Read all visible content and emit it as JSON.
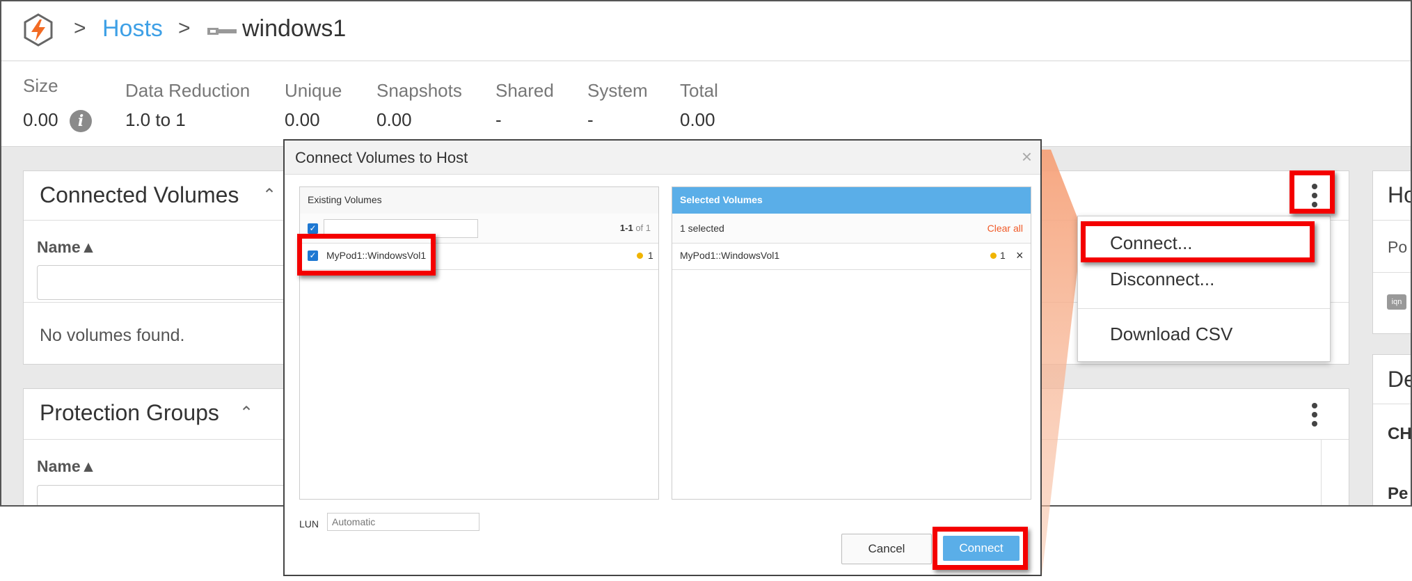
{
  "breadcrumb": {
    "sep1": ">",
    "hosts": "Hosts",
    "sep2": ">",
    "host": "windows1"
  },
  "stats": {
    "size_label": "Size",
    "size_value": "0.00",
    "info_icon": "i",
    "data_reduction_label": "Data Reduction",
    "data_reduction_value": "1.0 to 1",
    "unique_label": "Unique",
    "unique_value": "0.00",
    "snapshots_label": "Snapshots",
    "snapshots_value": "0.00",
    "shared_label": "Shared",
    "shared_value": "-",
    "system_label": "System",
    "system_value": "-",
    "total_label": "Total",
    "total_value": "0.00"
  },
  "connected_volumes": {
    "title": "Connected Volumes",
    "col_name": "Name▲",
    "empty": "No volumes found."
  },
  "protection_groups": {
    "title": "Protection Groups",
    "col_name": "Name▲"
  },
  "right_panels": {
    "p1_title": "Ho",
    "p1_row": "Po",
    "p2_title": "De",
    "p2_row1": "CH",
    "p2_row2": "Pe"
  },
  "menu": {
    "items": [
      "Connect...",
      "Disconnect...",
      "Download CSV"
    ]
  },
  "modal": {
    "title": "Connect Volumes to Host",
    "close": "×",
    "existing": {
      "header": "Existing Volumes",
      "count_bold": "1-1",
      "count_rest": " of 1",
      "rows": [
        {
          "name": "MyPod1::WindowsVol1",
          "count": "1"
        }
      ]
    },
    "selected": {
      "header": "Selected Volumes",
      "count": "1 selected",
      "clear": "Clear all",
      "rows": [
        {
          "name": "MyPod1::WindowsVol1",
          "count": "1",
          "remove": "×"
        }
      ]
    },
    "lun_label": "LUN",
    "lun_placeholder": "Automatic",
    "cancel": "Cancel",
    "connect": "Connect"
  },
  "colors": {
    "accent": "#3ea0e6",
    "highlight": "#f40000",
    "callout": "#f7a77b",
    "clear_all": "#f05a28",
    "status_dot": "#f0b400"
  },
  "icons": [
    "logo-icon",
    "host-icon",
    "info-icon",
    "chevron-up-icon",
    "kebab-icon",
    "checkbox-icon",
    "close-icon",
    "iqn-icon"
  ]
}
